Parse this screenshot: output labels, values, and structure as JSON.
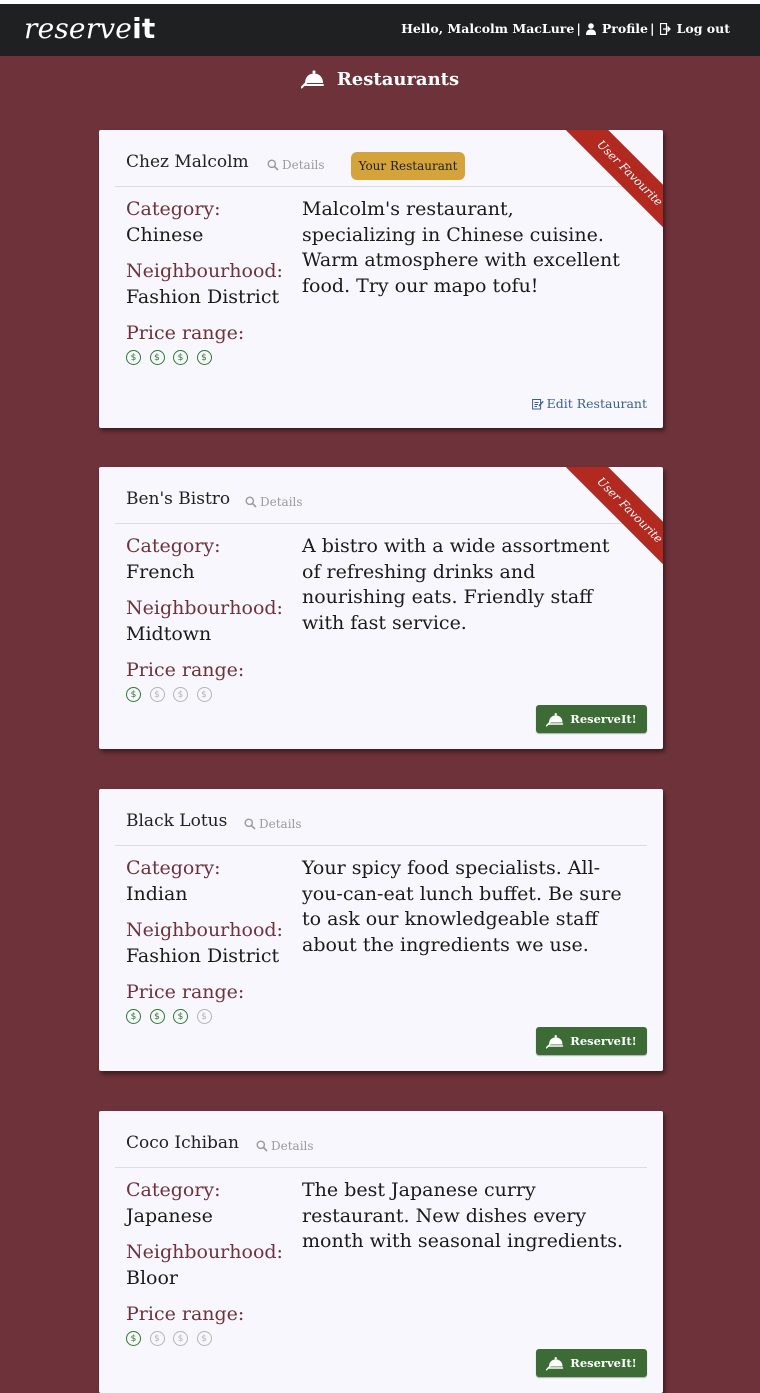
{
  "header": {
    "brand_light": "reserve",
    "brand_bold": "it",
    "greeting": "Hello, Malcolm MacLure",
    "profile_label": "Profile",
    "logout_label": "Log out"
  },
  "page_title": "Restaurants",
  "labels": {
    "category": "Category:",
    "neighbourhood": "Neighbourhood:",
    "price": "Price range:",
    "details": "Details",
    "reserve": "ReserveIt!",
    "edit": "Edit Restaurant",
    "favourite": "User Favourite",
    "owner": "Your Restaurant"
  },
  "colors": {
    "background": "#6e323a",
    "navbar": "#1e2021",
    "card": "#f7f7fd",
    "label": "#6e323a",
    "badge": "#d4a43b",
    "ribbon": "#b1291f",
    "reserve_button": "#3d6b36",
    "price_active": "#2f7a2f",
    "price_inactive": "#b5b5b5"
  },
  "restaurants": [
    {
      "name": "Chez Malcolm",
      "category": "Chinese",
      "neighbourhood": "Fashion District",
      "description": "Malcolm's restaurant, specializing in Chinese cuisine. Warm atmosphere with excellent food. Try our mapo tofu!",
      "price_level": 4,
      "price_max": 4,
      "is_owner": true,
      "is_favourite": true
    },
    {
      "name": "Ben's Bistro",
      "category": "French",
      "neighbourhood": "Midtown",
      "description": "A bistro with a wide assortment of refreshing drinks and nourishing eats. Friendly staff with fast service.",
      "price_level": 1,
      "price_max": 4,
      "is_owner": false,
      "is_favourite": true
    },
    {
      "name": "Black Lotus",
      "category": "Indian",
      "neighbourhood": "Fashion District",
      "description": "Your spicy food specialists. All-you-can-eat lunch buffet. Be sure to ask our knowledgeable staff about the ingredients we use.",
      "price_level": 3,
      "price_max": 4,
      "is_owner": false,
      "is_favourite": false
    },
    {
      "name": "Coco Ichiban",
      "category": "Japanese",
      "neighbourhood": "Bloor",
      "description": "The best Japanese curry restaurant. New dishes every month with seasonal ingredients.",
      "price_level": 1,
      "price_max": 4,
      "is_owner": false,
      "is_favourite": false
    }
  ]
}
